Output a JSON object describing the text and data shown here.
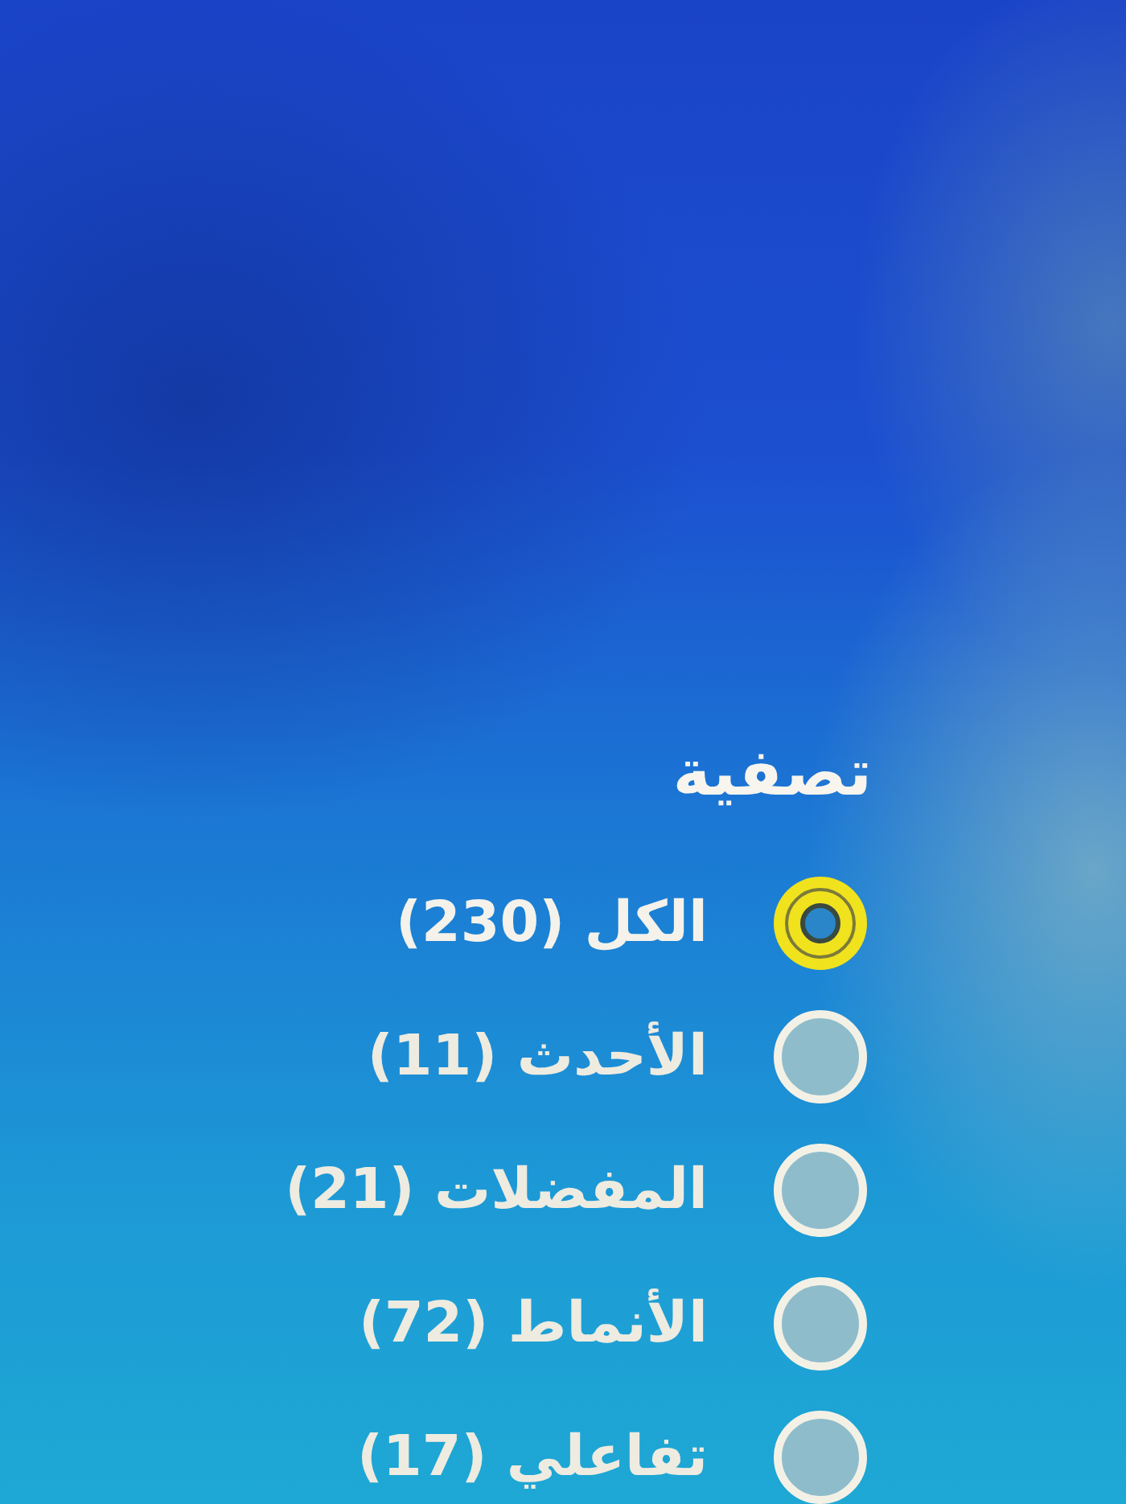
{
  "title": "تصفية",
  "options": [
    {
      "label": "الكل (230)",
      "selected": true
    },
    {
      "label": "الأحدث (11)",
      "selected": false
    },
    {
      "label": "المفضلات (21)",
      "selected": false
    },
    {
      "label": "الأنماط (72)",
      "selected": false
    },
    {
      "label": "تفاعلي (17)",
      "selected": false
    }
  ]
}
